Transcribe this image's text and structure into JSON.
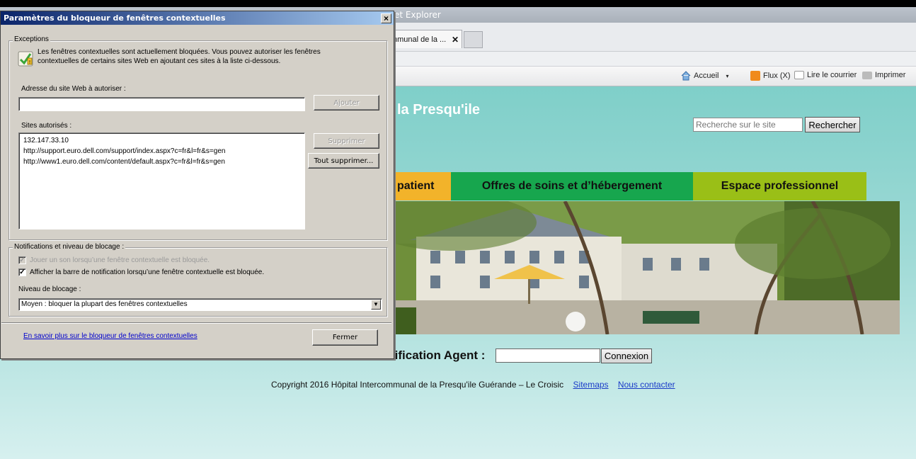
{
  "browser": {
    "title_fragment": "et Explorer",
    "tab_label": "nmunal de la ...",
    "tab_close": "✕",
    "commands": [
      "Accueil",
      "Flux (X)",
      "Lire le courrier",
      "Imprimer"
    ]
  },
  "site": {
    "title_fragment": "la Presqu'ile",
    "search_placeholder": "Recherche sur le site",
    "search_button": "Rechercher",
    "nav": [
      "patient",
      "Offres de soins et d’hébergement",
      "Espace professionnel"
    ],
    "nav_colors": [
      "#f2b32a",
      "#17a64e",
      "#9abf17"
    ],
    "auth_label": "tification Agent :",
    "auth_button": "Connexion",
    "footer_text": "Copyright 2016 Hôpital Intercommunal de la Presqu'ile Guérande – Le Croisic",
    "footer_links": [
      "Sitemaps",
      "Nous contacter"
    ]
  },
  "dialog": {
    "title": "Paramètres du bloqueur de fenêtres contextuelles",
    "close": "×",
    "exceptions_legend": "Exceptions",
    "info_line1": "Les fenêtres contextuelles sont actuellement bloquées.  Vous pouvez autoriser les fenêtres",
    "info_line2": "contextuelles de certains sites Web en ajoutant ces sites à la liste ci-dessous.",
    "address_label": "Adresse du site Web à autoriser :",
    "address_value": "",
    "add_button": "Ajouter",
    "allowed_label": "Sites autorisés :",
    "allowed_sites": [
      "132.147.33.10",
      "http://support.euro.dell.com/support/index.aspx?c=fr&l=fr&s=gen",
      "http://www1.euro.dell.com/content/default.aspx?c=fr&l=fr&s=gen"
    ],
    "remove_button": "Supprimer",
    "remove_all_button": "Tout supprimer...",
    "notifications_legend": "Notifications et niveau de blocage :",
    "play_sound_label": "Jouer un son lorsqu’une fenêtre contextuelle est bloquée.",
    "show_bar_label": "Afficher la barre de notification lorsqu’une fenêtre contextuelle est bloquée.",
    "check_mark": "✓",
    "level_label": "Niveau de blocage :",
    "level_value": "Moyen : bloquer la plupart des fenêtres contextuelles",
    "dropdown_arrow": "▼",
    "learn_more_link": "En savoir plus sur le bloqueur de fenêtres contextuelles",
    "close_button": "Fermer"
  }
}
